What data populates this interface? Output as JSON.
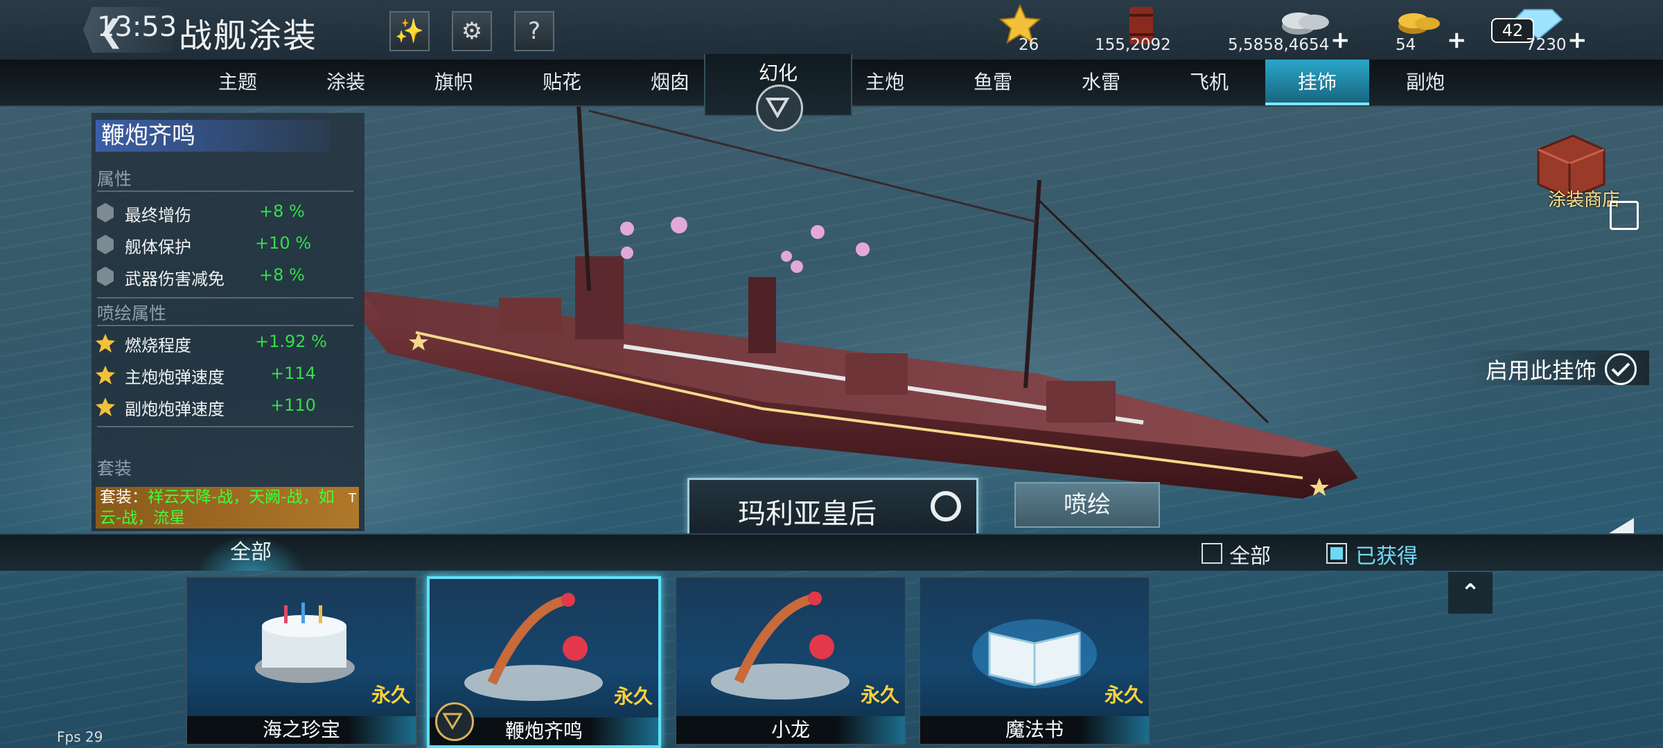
{
  "status": {
    "time": "13:53",
    "fps": "Fps 29"
  },
  "header": {
    "title": "战舰涂装"
  },
  "resources": [
    {
      "icon": "star-medal-icon",
      "value": "26"
    },
    {
      "icon": "oil-barrel-icon",
      "value": "155,2092"
    },
    {
      "icon": "silver-coins-icon",
      "value": "5,5858,4654"
    },
    {
      "icon": "gold-coins-icon",
      "value": "54"
    },
    {
      "icon": "diamond-icon",
      "value": "7230",
      "badge": "42"
    }
  ],
  "tabs_left": [
    "主题",
    "涂装",
    "旗帜",
    "贴花",
    "烟囱"
  ],
  "center_tab": "幻化",
  "tabs_right": [
    "主炮",
    "鱼雷",
    "水雷",
    "飞机",
    "挂饰",
    "副炮"
  ],
  "active_tab": "挂饰",
  "panel": {
    "title": "鞭炮齐鸣",
    "attr_header": "属性",
    "attrs": [
      {
        "name": "最终增伤",
        "value": "+8 %"
      },
      {
        "name": "舰体保护",
        "value": "+10 %"
      },
      {
        "name": "武器伤害减免",
        "value": "+8 %"
      }
    ],
    "paint_header": "喷绘属性",
    "paint_attrs": [
      {
        "name": "燃烧程度",
        "value": "+1.92 %"
      },
      {
        "name": "主炮炮弹速度",
        "value": "+114"
      },
      {
        "name": "副炮炮弹速度",
        "value": "+110"
      }
    ],
    "set_header": "套装",
    "set_lead": "套装：",
    "set_text": "祥云天降-战，天阙-战，如云-战，流星",
    "set_tag": "T"
  },
  "shop_label": "涂装商店",
  "enable_label": "启用此挂饰",
  "ship_name": "玛利亚皇后",
  "paint_button": "喷绘",
  "filter": {
    "all_tab": "全部",
    "opt_all": "全部",
    "opt_owned": "已获得"
  },
  "cards": [
    {
      "name": "海之珍宝",
      "duration": "永久",
      "icon": "cake-icon"
    },
    {
      "name": "鞭炮齐鸣",
      "duration": "永久",
      "icon": "firecracker-icon",
      "selected": true
    },
    {
      "name": "小龙",
      "duration": "永久",
      "icon": "dragon-icon"
    },
    {
      "name": "魔法书",
      "duration": "永久",
      "icon": "magic-book-icon"
    }
  ],
  "colors": {
    "accent": "#2aa6c8",
    "positive": "#33e04a",
    "gold": "#ffd23a",
    "highlight": "#5ee0f8"
  }
}
